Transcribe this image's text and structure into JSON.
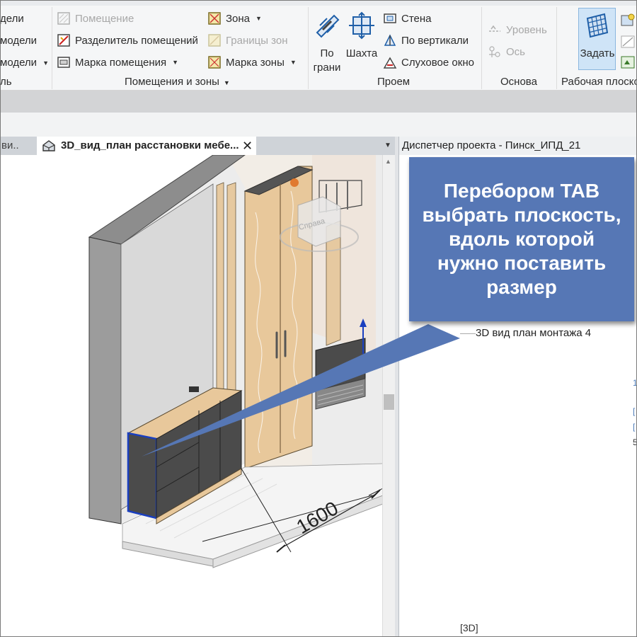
{
  "ribbon": {
    "model_panel": {
      "items": [
        "дели",
        "модели",
        "модели"
      ],
      "title": "ль"
    },
    "rooms_panel": {
      "room": "Помещение",
      "room_separator": "Разделитель помещений",
      "room_tag": "Марка помещения",
      "area": "Зона",
      "area_boundary": "Границы  зон",
      "area_tag": "Марка  зоны",
      "title": "Помещения и зоны"
    },
    "opening_panel": {
      "by_face": [
        "По",
        "грани"
      ],
      "shaft": "Шахта",
      "wall": "Стена",
      "vertical": "По вертикали",
      "dormer": "Слуховое окно",
      "title": "Проем"
    },
    "datum_panel": {
      "level": "Уровень",
      "grid": "Ось",
      "title": "Основа"
    },
    "workplane_panel": {
      "set": "Задать",
      "title": "Рабочая плоскос"
    }
  },
  "tabs": {
    "inactive": "ви..",
    "active": "3D_вид_план расстановки мебе..."
  },
  "viewport": {
    "dimension_value": "1600",
    "viewcube_label": "Справа"
  },
  "project_browser": {
    "title": "Диспетчер проекта - Пинск_ИПД_21",
    "visible_item": "3D вид план монтажа 4",
    "bottom_item": "[3D]"
  },
  "callout": {
    "text": "Перебором TAB выбрать плоскость, вдоль которой нужно поставить размер",
    "color": "#5677b5"
  },
  "colors": {
    "ribbon_bg": "#f5f6f7",
    "wood": "#e6c9a0",
    "wall_grey": "#a9a9a9",
    "cabinet_dark": "#4b4b4b",
    "selection_blue": "#1a3fbf"
  }
}
